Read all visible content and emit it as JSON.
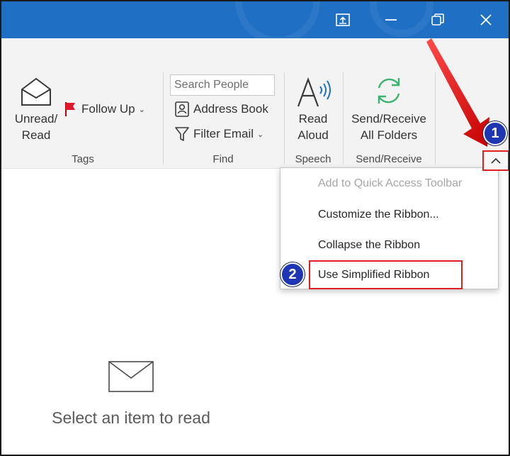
{
  "window": {
    "icons": [
      "restore-window-icon",
      "minimize-icon",
      "maximize-icon",
      "close-icon"
    ]
  },
  "ribbon": {
    "tags": {
      "unread_read_line1": "Unread/",
      "unread_read_line2": "Read",
      "follow_up": "Follow Up",
      "label": "Tags"
    },
    "find": {
      "search_placeholder": "Search People",
      "address_book": "Address Book",
      "filter_email": "Filter Email",
      "label": "Find"
    },
    "speech": {
      "read_aloud_line1": "Read",
      "read_aloud_line2": "Aloud",
      "label": "Speech"
    },
    "send_receive": {
      "button_line1": "Send/Receive",
      "button_line2": "All Folders",
      "label": "Send/Receive"
    }
  },
  "context_menu": {
    "items": [
      {
        "label": "Add to Quick Access Toolbar",
        "enabled": false
      },
      {
        "label": "Customize the Ribbon...",
        "enabled": true
      },
      {
        "label": "Collapse the Ribbon",
        "enabled": true
      },
      {
        "label": "Use Simplified Ribbon",
        "enabled": true
      }
    ]
  },
  "annotations": {
    "step1": "1",
    "step2": "2",
    "highlight_color": "#e02020",
    "badge_color": "#1e35b4"
  },
  "reading_pane": {
    "message": "Select an item to read"
  },
  "colors": {
    "titlebar": "#1f6fc5",
    "ribbon": "#f3f3f3",
    "send_receive_icon": "#3cb371"
  }
}
